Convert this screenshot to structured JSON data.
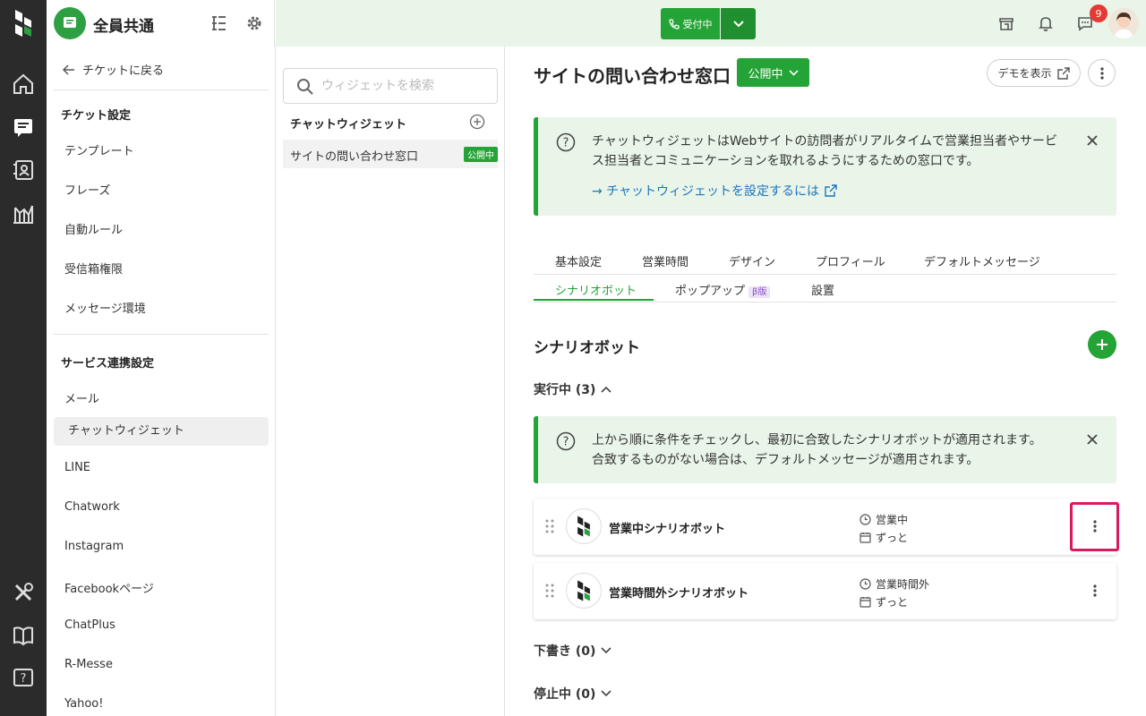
{
  "header": {
    "workspace_title": "全員共通",
    "call_status": "受付中",
    "notification_count": "9"
  },
  "sidebar": {
    "back_label": "チケットに戻る",
    "section1_title": "チケット設定",
    "section1_items": [
      "テンプレート",
      "フレーズ",
      "自動ルール",
      "受信箱権限",
      "メッセージ環境"
    ],
    "section2_title": "サービス連携設定",
    "section2_items": [
      "メール",
      "チャットウィジェット",
      "LINE",
      "Chatwork",
      "Instagram",
      "Facebookページ",
      "ChatPlus",
      "R-Messe",
      "Yahoo!"
    ]
  },
  "widget_list": {
    "search_placeholder": "ウィジェットを検索",
    "heading": "チャットウィジェット",
    "items": [
      {
        "label": "サイトの問い合わせ窓口",
        "status": "公開中"
      }
    ]
  },
  "main": {
    "title": "サイトの問い合わせ窓口",
    "status": "公開中",
    "demo_label": "デモを表示",
    "info1": {
      "line1": "チャットウィジェットはWebサイトの訪問者がリアルタイムで営業担当者やサービ",
      "line2": "ス担当者とコミュニケーションを取れるようにするための窓口です。",
      "link": "→ チャットウィジェットを設定するには"
    },
    "tabs_row1": [
      "基本設定",
      "営業時間",
      "デザイン",
      "プロフィール",
      "デフォルトメッセージ"
    ],
    "tabs_row2": [
      "シナリオボット",
      "ポップアップ",
      "設置"
    ],
    "beta_label": "β版",
    "section_title": "シナリオボット",
    "running_label": "実行中 (3)",
    "info2": {
      "line1": "上から順に条件をチェックし、最初に合致したシナリオボットが適用されます。",
      "line2": "合致するものがない場合は、デフォルトメッセージが適用されます。"
    },
    "bots": [
      {
        "name": "営業中シナリオボット",
        "time": "営業中",
        "period": "ずっと"
      },
      {
        "name": "営業時間外シナリオボット",
        "time": "営業時間外",
        "period": "ずっと"
      }
    ],
    "draft_label": "下書き (0)",
    "stopped_label": "停止中 (0)"
  },
  "colors": {
    "accent": "#24a336",
    "highlight": "#d81b60"
  }
}
